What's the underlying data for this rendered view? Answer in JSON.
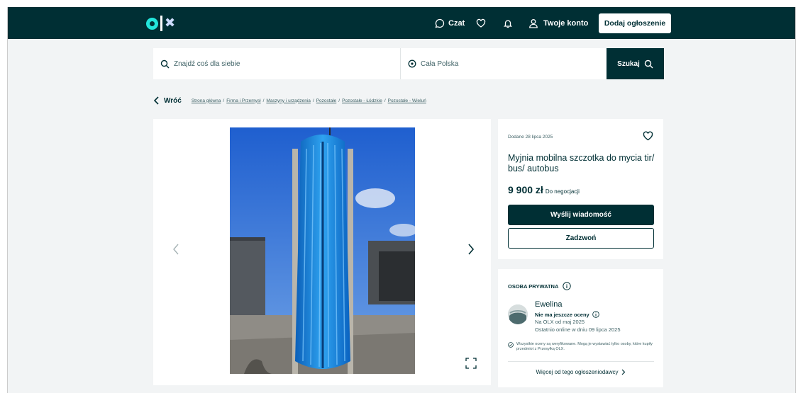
{
  "header": {
    "logo": "olx",
    "chat_label": "Czat",
    "account_label": "Twoje konto",
    "add_label": "Dodaj ogłoszenie"
  },
  "search": {
    "placeholder": "Znajdź coś dla siebie",
    "location": "Cała Polska",
    "button_label": "Szukaj"
  },
  "breadcrumb": {
    "back_label": "Wróć",
    "items": [
      "Strona główna",
      "Firma i Przemysł",
      "Maszyny i urządzenia",
      "Pozostałe",
      "Pozostałe - Łódzkie",
      "Pozostałe - Wieluń"
    ]
  },
  "listing": {
    "added": "Dodane 28 lipca 2025",
    "title": "Myjnia mobilna szczotka do mycia tir/ bus/ autobus",
    "price": "9 900 zł",
    "negotiable": "Do negocjacji",
    "message_label": "Wyślij wiadomość",
    "call_label": "Zadzwoń"
  },
  "seller": {
    "type": "OSOBA PRYWATNA",
    "name": "Ewelina",
    "rating": "Nie ma jeszcze oceny",
    "since": "Na OLX od maj 2025",
    "last_online": "Ostatnio online w dniu 09 lipca 2025",
    "verified_note": "Wszystkie oceny są weryfikowane. Mogą je wystawiać tylko osoby, które kupiły przedmiot z Przesyłką OLX.",
    "more_label": "Więcej od tego ogłoszeniodawcy"
  },
  "colors": {
    "brand_dark": "#002f34",
    "logo_teal": "#23e5db",
    "background": "#f2f4f5"
  }
}
